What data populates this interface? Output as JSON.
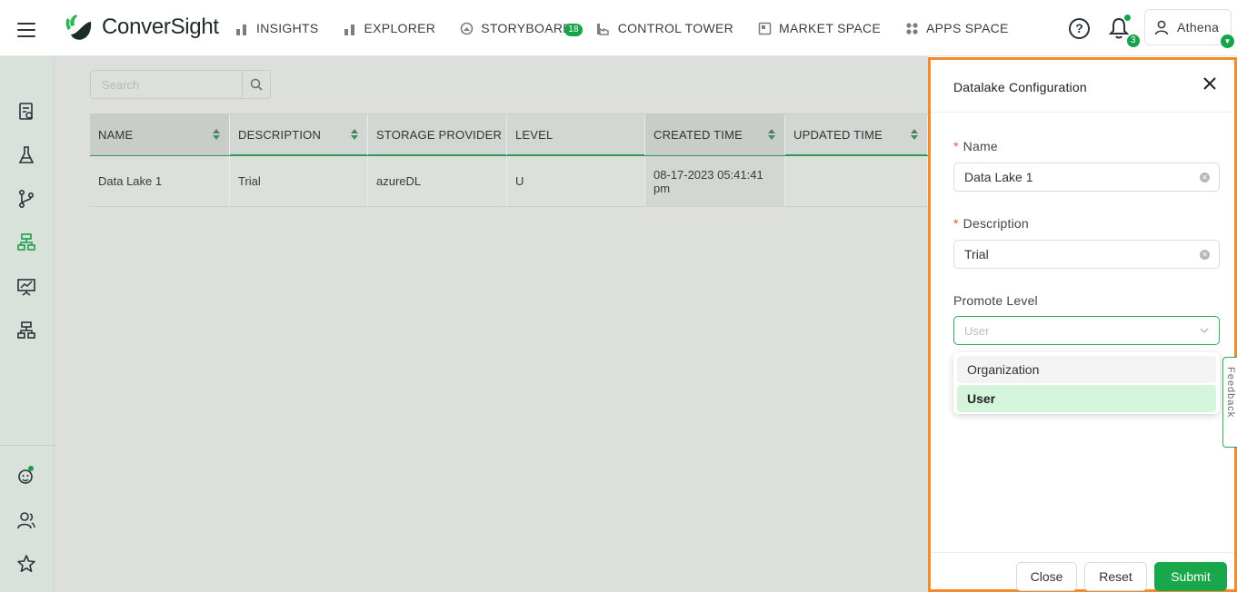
{
  "app": {
    "brand": "ConverSight",
    "accent_color": "#17a34a",
    "highlight_border": "#f28a2e"
  },
  "nav": {
    "items": [
      {
        "label": "INSIGHTS",
        "icon": "bar-chart-icon"
      },
      {
        "label": "EXPLORER",
        "icon": "bar-chart-icon"
      },
      {
        "label": "STORYBOARD",
        "icon": "storyboard-icon",
        "badge": "18"
      },
      {
        "label": "CONTROL TOWER",
        "icon": "factory-icon"
      },
      {
        "label": "MARKET SPACE",
        "icon": "store-icon"
      },
      {
        "label": "APPS SPACE",
        "icon": "grid-icon"
      }
    ]
  },
  "header": {
    "help_symbol": "?",
    "notification_count": "3",
    "user_name": "Athena"
  },
  "sidebar": {
    "items": [
      "report-icon",
      "flask-icon",
      "branch-icon",
      "hierarchy-icon",
      "presentation-icon",
      "network-icon"
    ],
    "bottom_items": [
      "bot-icon",
      "users-icon",
      "star-icon"
    ]
  },
  "search": {
    "placeholder": "Search",
    "value": ""
  },
  "table": {
    "columns": [
      "NAME",
      "DESCRIPTION",
      "STORAGE PROVIDER",
      "LEVEL",
      "CREATED TIME",
      "UPDATED TIME"
    ],
    "rows": [
      {
        "name": "Data Lake 1",
        "description": "Trial",
        "storage_provider": "azureDL",
        "level": "U",
        "created_time": "08-17-2023 05:41:41 pm",
        "updated_time": ""
      }
    ]
  },
  "drawer": {
    "title": "Datalake Configuration",
    "name_label": "Name",
    "name_value": "Data Lake 1",
    "description_label": "Description",
    "description_value": "Trial",
    "promote_label": "Promote Level",
    "promote_placeholder": "User",
    "required_mark": "*",
    "options": [
      "Organization",
      "User"
    ],
    "selected_option": "User",
    "feedback_label": "Feedback",
    "buttons": {
      "close": "Close",
      "reset": "Reset",
      "submit": "Submit"
    }
  }
}
